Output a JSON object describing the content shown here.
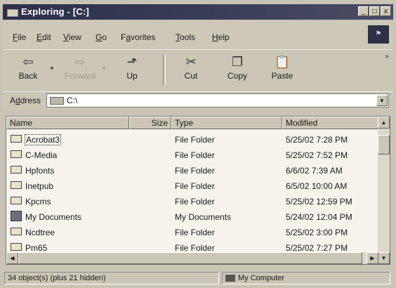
{
  "window": {
    "title": "Exploring - [C:]"
  },
  "window_buttons": [
    "_",
    "□",
    "x"
  ],
  "menu": [
    {
      "label": "File",
      "ul": "F",
      "rest": "ile"
    },
    {
      "label": "Edit",
      "ul": "E",
      "rest": "dit"
    },
    {
      "label": "View",
      "ul": "V",
      "rest": "iew"
    },
    {
      "label": "Go",
      "ul": "G",
      "rest": "o"
    },
    {
      "label": "Favorites",
      "ul": "a",
      "pre": "F",
      "rest": "vorites"
    },
    {
      "label": "Tools",
      "ul": "T",
      "rest": "ools"
    },
    {
      "label": "Help",
      "ul": "H",
      "rest": "elp"
    }
  ],
  "toolbar": {
    "back": "Back",
    "forward": "Forward",
    "up": "Up",
    "cut": "Cut",
    "copy": "Copy",
    "paste": "Paste",
    "more": "»"
  },
  "address": {
    "label_ul": "d",
    "label_pre": "A",
    "label_rest": "dress",
    "value": "C:\\"
  },
  "columns": {
    "name": "Name",
    "size": "Size",
    "type": "Type",
    "modified": "Modified"
  },
  "files": [
    {
      "name": "Acrobat3",
      "type": "File Folder",
      "modified": "5/25/02 7:28 PM",
      "icon": "folder-icon"
    },
    {
      "name": "C-Media",
      "type": "File Folder",
      "modified": "5/25/02 7:52 PM",
      "icon": "folder-icon"
    },
    {
      "name": "Hpfonts",
      "type": "File Folder",
      "modified": "6/6/02 7:39 AM",
      "icon": "folder-icon"
    },
    {
      "name": "Inetpub",
      "type": "File Folder",
      "modified": "6/5/02 10:00 AM",
      "icon": "folder-icon"
    },
    {
      "name": "Kpcms",
      "type": "File Folder",
      "modified": "5/25/02 12:59 PM",
      "icon": "folder-icon"
    },
    {
      "name": "My Documents",
      "type": "My Documents",
      "modified": "5/24/02 12:04 PM",
      "icon": "my-documents-icon"
    },
    {
      "name": "Ncdtree",
      "type": "File Folder",
      "modified": "5/25/02 3:00 PM",
      "icon": "folder-icon"
    },
    {
      "name": "Pm65",
      "type": "File Folder",
      "modified": "5/25/02 7:27 PM",
      "icon": "folder-icon"
    }
  ],
  "status": {
    "objects": "34 object(s) (plus 21 hidden)",
    "location": "My Computer"
  },
  "colors": {
    "titlebar": "#2b2f4a",
    "chrome": "#cbc6b6",
    "list_bg": "#f5f3ec"
  }
}
